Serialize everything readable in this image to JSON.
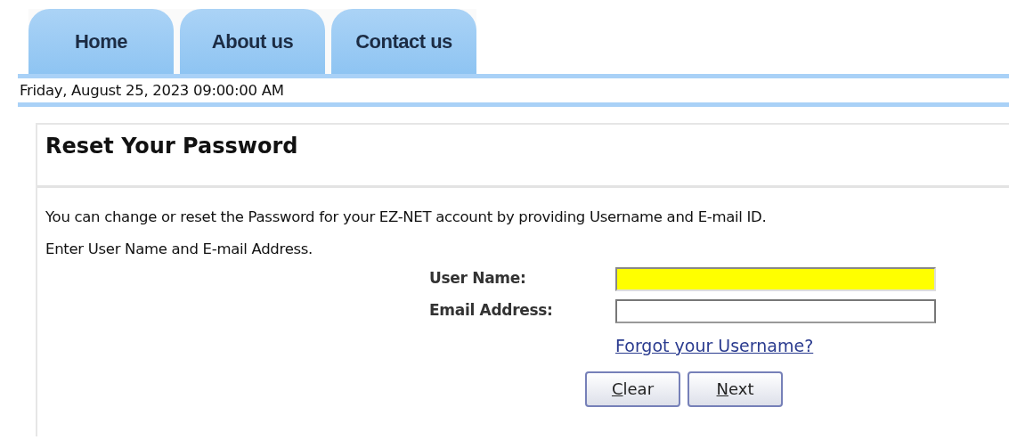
{
  "tabs": [
    {
      "label": "Home"
    },
    {
      "label": "About us"
    },
    {
      "label": "Contact us"
    }
  ],
  "date_bar": "Friday, August 25, 2023 09:00:00 AM",
  "panel": {
    "title": "Reset Your Password",
    "paragraphs": [
      "You can change or reset the Password for your EZ-NET account by providing Username and E-mail ID.",
      "Enter User Name and E-mail Address."
    ]
  },
  "fields": [
    {
      "label": "User Name:",
      "focused": true
    },
    {
      "label": "Email Address:",
      "focused": false
    }
  ],
  "link": "Forgot your Username?",
  "buttons": [
    "Clear",
    "Next"
  ]
}
